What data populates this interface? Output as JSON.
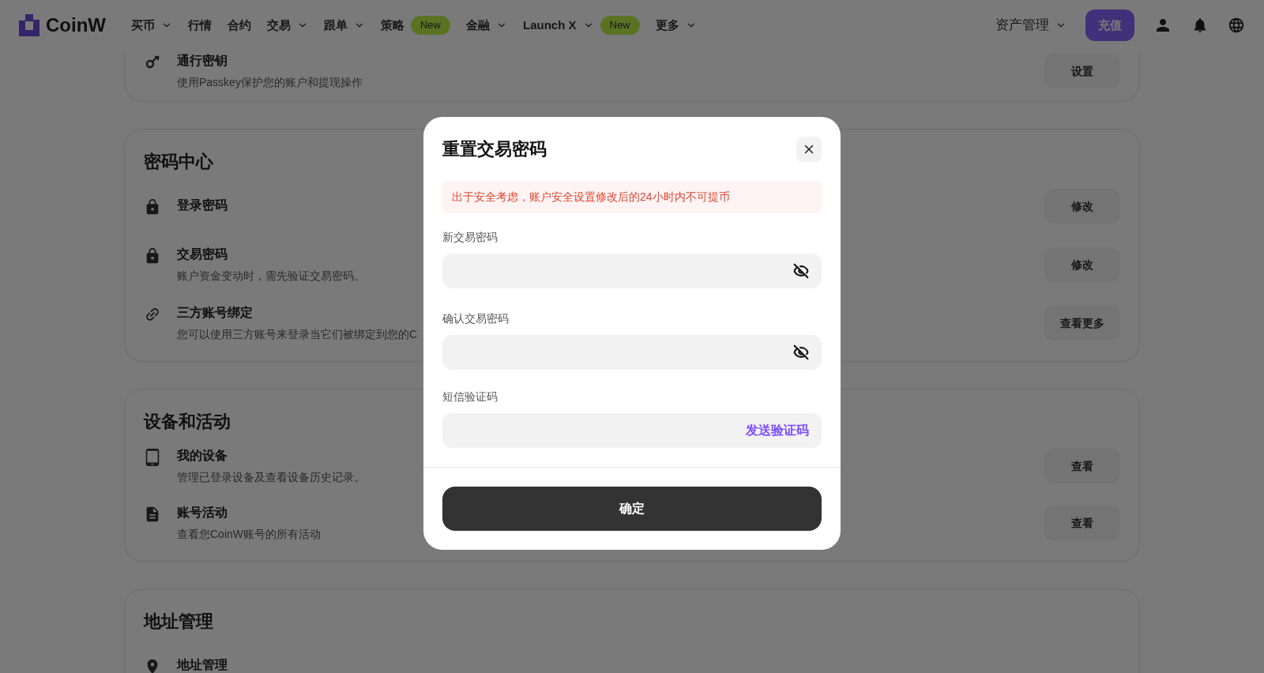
{
  "nav": {
    "logo": "CoinW",
    "items": [
      {
        "label": "买币",
        "dropdown": true
      },
      {
        "label": "行情",
        "dropdown": false
      },
      {
        "label": "合约",
        "dropdown": false
      },
      {
        "label": "交易",
        "dropdown": true
      },
      {
        "label": "跟单",
        "dropdown": true
      },
      {
        "label": "策略",
        "dropdown": false,
        "badge": "New"
      },
      {
        "label": "金融",
        "dropdown": true
      },
      {
        "label": "Launch X",
        "dropdown": true,
        "badge": "New"
      },
      {
        "label": "更多",
        "dropdown": true
      }
    ],
    "asset_menu": "资产管理",
    "deposit_button": "充值"
  },
  "sections": [
    {
      "items": [
        {
          "kind": "key",
          "title": "通行密钥",
          "description": "使用Passkey保护您的账户和提现操作",
          "button": "设置"
        }
      ]
    },
    {
      "title": "密码中心",
      "items": [
        {
          "kind": "lock",
          "title": "登录密码",
          "button": "修改"
        },
        {
          "kind": "lock",
          "title": "交易密码",
          "description": "账户资金变动时，需先验证交易密码。",
          "button": "修改"
        },
        {
          "kind": "link",
          "title": "三方账号绑定",
          "description": "您可以使用三方账号来登录当它们被绑定到您的C",
          "button": "查看更多"
        }
      ]
    },
    {
      "title": "设备和活动",
      "items": [
        {
          "kind": "device",
          "title": "我的设备",
          "description": "管理已登录设备及查看设备历史记录。",
          "button": "查看"
        },
        {
          "kind": "document",
          "title": "账号活动",
          "description": "查看您CoinW账号的所有活动",
          "button": "查看"
        }
      ]
    },
    {
      "title": "地址管理",
      "items": [
        {
          "kind": "location",
          "title": "地址管理"
        }
      ]
    }
  ],
  "dialog": {
    "title": "重置交易密码",
    "notice": "出于安全考虑，账户安全设置修改后的24小时内不可提币",
    "fields": [
      {
        "kind": "password",
        "label": "新交易密码"
      },
      {
        "kind": "password",
        "label": "确认交易密码"
      },
      {
        "kind": "code",
        "label": "短信验证码",
        "action": "发送验证码"
      }
    ],
    "confirm_button": "确定"
  }
}
